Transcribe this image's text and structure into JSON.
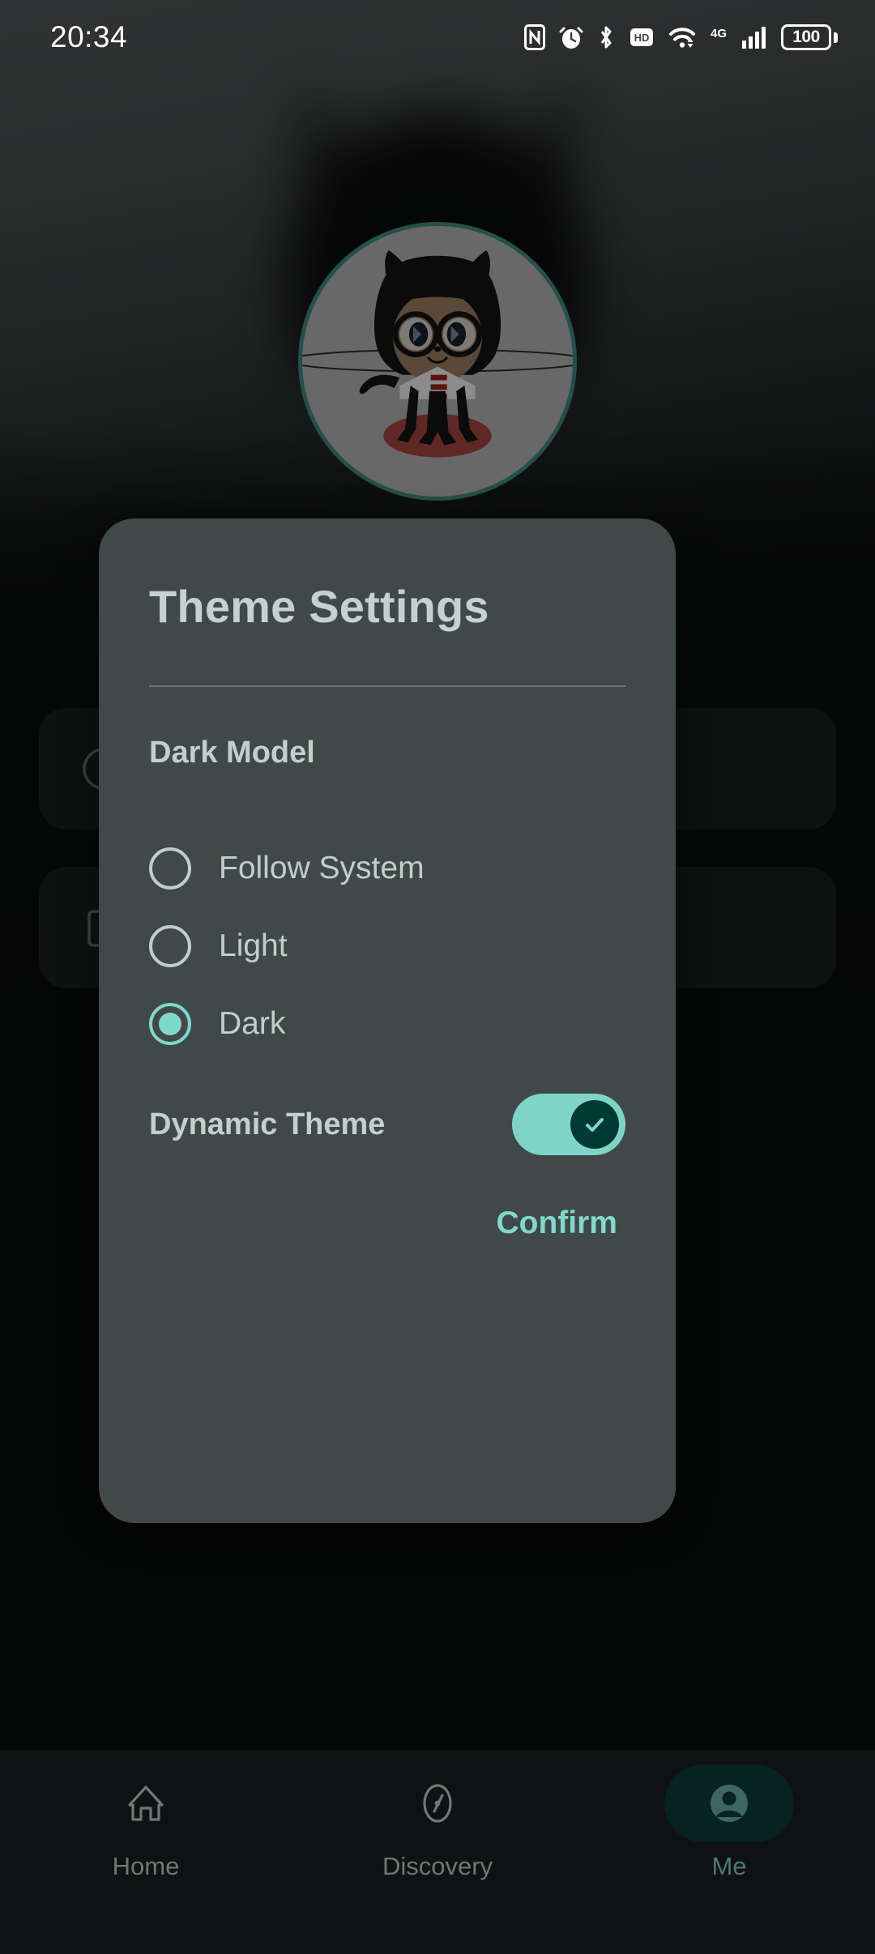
{
  "statusbar": {
    "time": "20:34",
    "battery_level": "100",
    "icons": [
      "nfc-icon",
      "alarm-icon",
      "bluetooth-icon",
      "hd-icon",
      "wifi-icon",
      "network-4g-icon",
      "signal-bars-icon",
      "battery-icon"
    ]
  },
  "profile": {
    "avatar_icon": "octocat-avatar",
    "avatar_ring_color": "#3f8a80"
  },
  "background_cards": [
    {
      "icon": "theme-palette-icon",
      "label": ""
    },
    {
      "icon": "square-outline-icon",
      "label": ""
    }
  ],
  "dialog": {
    "title": "Theme Settings",
    "section_title": "Dark Model",
    "options": [
      {
        "label": "Follow System",
        "selected": false
      },
      {
        "label": "Light",
        "selected": false
      },
      {
        "label": "Dark",
        "selected": true
      }
    ],
    "dynamic_theme": {
      "label": "Dynamic Theme",
      "enabled": true,
      "track_color": "#7fd4c8",
      "thumb_color": "#003a33",
      "check_icon": "check-icon"
    },
    "confirm_label": "Confirm",
    "accent_color": "#7fd8cc",
    "surface_color": "#414948"
  },
  "bottomnav": {
    "items": [
      {
        "label": "Home",
        "icon": "home-icon",
        "active": false
      },
      {
        "label": "Discovery",
        "icon": "compass-icon",
        "active": false
      },
      {
        "label": "Me",
        "icon": "person-icon",
        "active": true
      }
    ],
    "active_pill_color": "#06231f"
  }
}
